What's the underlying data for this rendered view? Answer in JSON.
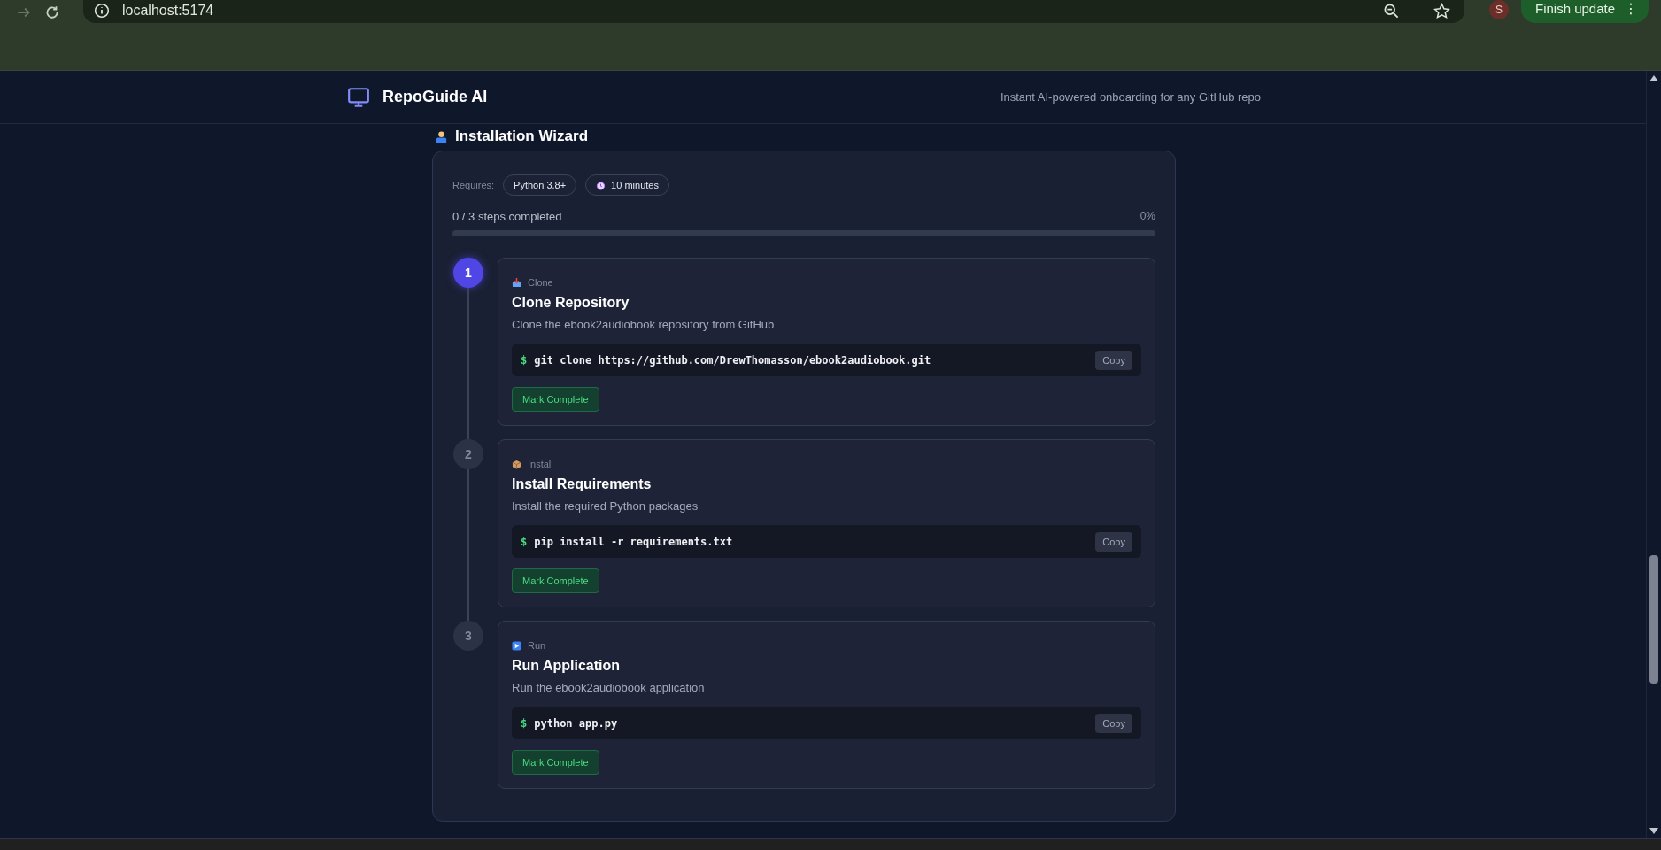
{
  "browser": {
    "url": "localhost:5174",
    "profile_initial": "S",
    "update_button": "Finish update",
    "menu": "⋮"
  },
  "header": {
    "app_name": "RepoGuide AI",
    "tagline": "Instant AI-powered onboarding for any GitHub repo"
  },
  "section_title": "Installation Wizard",
  "wizard": {
    "requires_label": "Requires:",
    "requirements": [
      {
        "kind": "plain",
        "text": "Python 3.8+"
      },
      {
        "kind": "time",
        "text": "10 minutes"
      }
    ],
    "progress_text": "0 / 3 steps completed",
    "percent": "0%",
    "level": 0,
    "steps": [
      {
        "kind": "clone",
        "number": "1",
        "active": true,
        "category": "Clone",
        "title": "Clone Repository",
        "description": "Clone the ebook2audiobook repository from GitHub",
        "prompt": "$",
        "command": "git clone https://github.com/DrewThomasson/ebook2audiobook.git",
        "copy": "Copy",
        "action": "Mark Complete"
      },
      {
        "kind": "install",
        "number": "2",
        "active": false,
        "category": "Install",
        "title": "Install Requirements",
        "description": "Install the required Python packages",
        "prompt": "$",
        "command": "pip install -r requirements.txt",
        "copy": "Copy",
        "action": "Mark Complete"
      },
      {
        "kind": "run",
        "number": "3",
        "active": false,
        "category": "Run",
        "title": "Run Application",
        "description": "Run the ebook2audiobook application",
        "prompt": "$",
        "command": "python app.py",
        "copy": "Copy",
        "action": "Mark Complete"
      }
    ]
  }
}
